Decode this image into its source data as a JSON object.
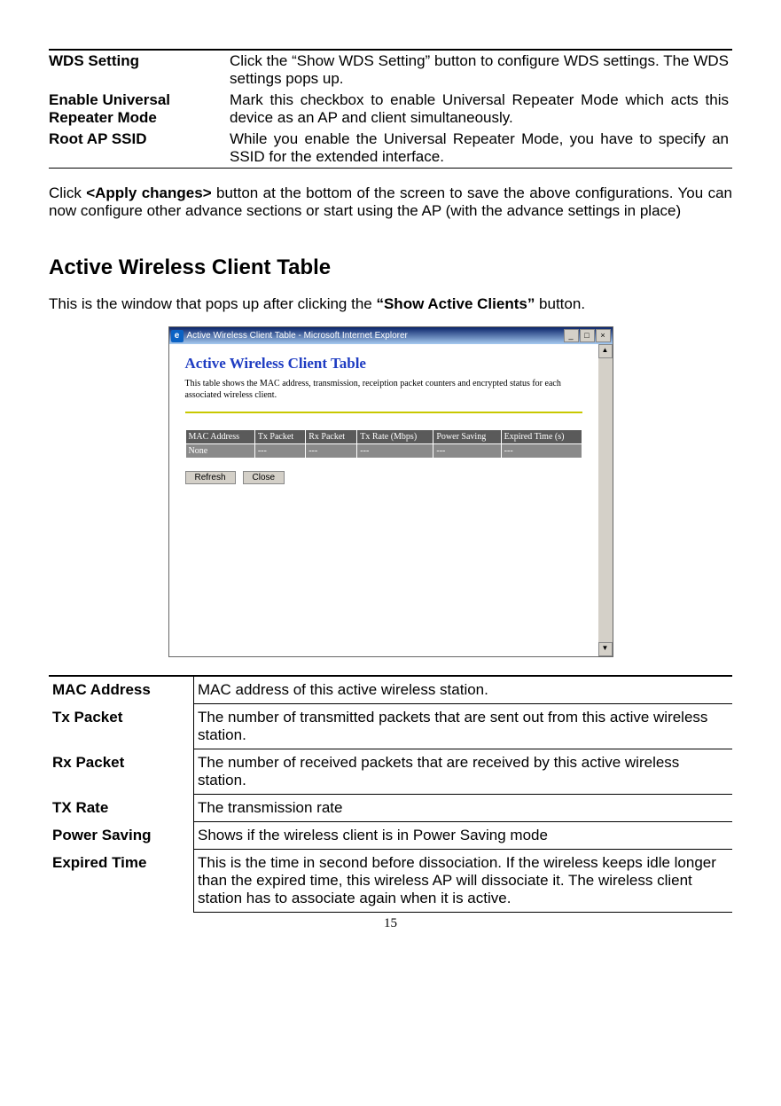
{
  "top_rows": [
    {
      "term": "WDS Setting",
      "desc": "Click the “Show WDS Setting” button to configure WDS settings. The WDS settings pops up."
    },
    {
      "term": "Enable Universal Repeater Mode",
      "desc": "Mark this checkbox to enable Universal Repeater Mode which acts this device as an AP and client simultaneously."
    },
    {
      "term": "Root AP SSID",
      "desc": "While you enable the Universal Repeater Mode, you have to specify an SSID for the extended interface."
    }
  ],
  "paragraph": {
    "pre": "Click ",
    "bold": "<Apply changes>",
    "post": " button at the bottom of the screen to save the above configurations. You can now configure other advance sections or start using the AP (with the advance settings in place)"
  },
  "heading": "Active Wireless Client Table",
  "intro": {
    "pre": "This is the window that pops up after clicking the ",
    "bold": "“Show Active Clients”",
    "post": " button."
  },
  "screenshot": {
    "title": "Active Wireless Client Table - Microsoft Internet Explorer",
    "page_title": "Active Wireless Client Table",
    "description": "This table shows the MAC address, transmission, receiption packet counters and encrypted status for each associated wireless client.",
    "columns": [
      "MAC Address",
      "Tx Packet",
      "Rx Packet",
      "Tx Rate (Mbps)",
      "Power Saving",
      "Expired Time (s)"
    ],
    "row": [
      "None",
      "---",
      "---",
      "---",
      "---",
      "---"
    ],
    "refresh": "Refresh",
    "close": "Close",
    "min": "_",
    "max": "□",
    "x": "×"
  },
  "def_rows": [
    {
      "term": "MAC Address",
      "desc": "MAC address of this active wireless station."
    },
    {
      "term": "Tx Packet",
      "desc": "The number of transmitted packets that are sent out from this active wireless station."
    },
    {
      "term": "Rx Packet",
      "desc": "The number of received packets that are received by this active wireless station."
    },
    {
      "term": "TX Rate",
      "desc": "The transmission rate"
    },
    {
      "term": "Power Saving",
      "desc": "Shows if the wireless client is in Power Saving mode"
    },
    {
      "term": "Expired Time",
      "desc": "This is the time in second before dissociation. If the wireless keeps idle longer than the expired time, this wireless AP will dissociate it. The wireless client station has to associate again when it is active."
    }
  ],
  "page_number": "15"
}
